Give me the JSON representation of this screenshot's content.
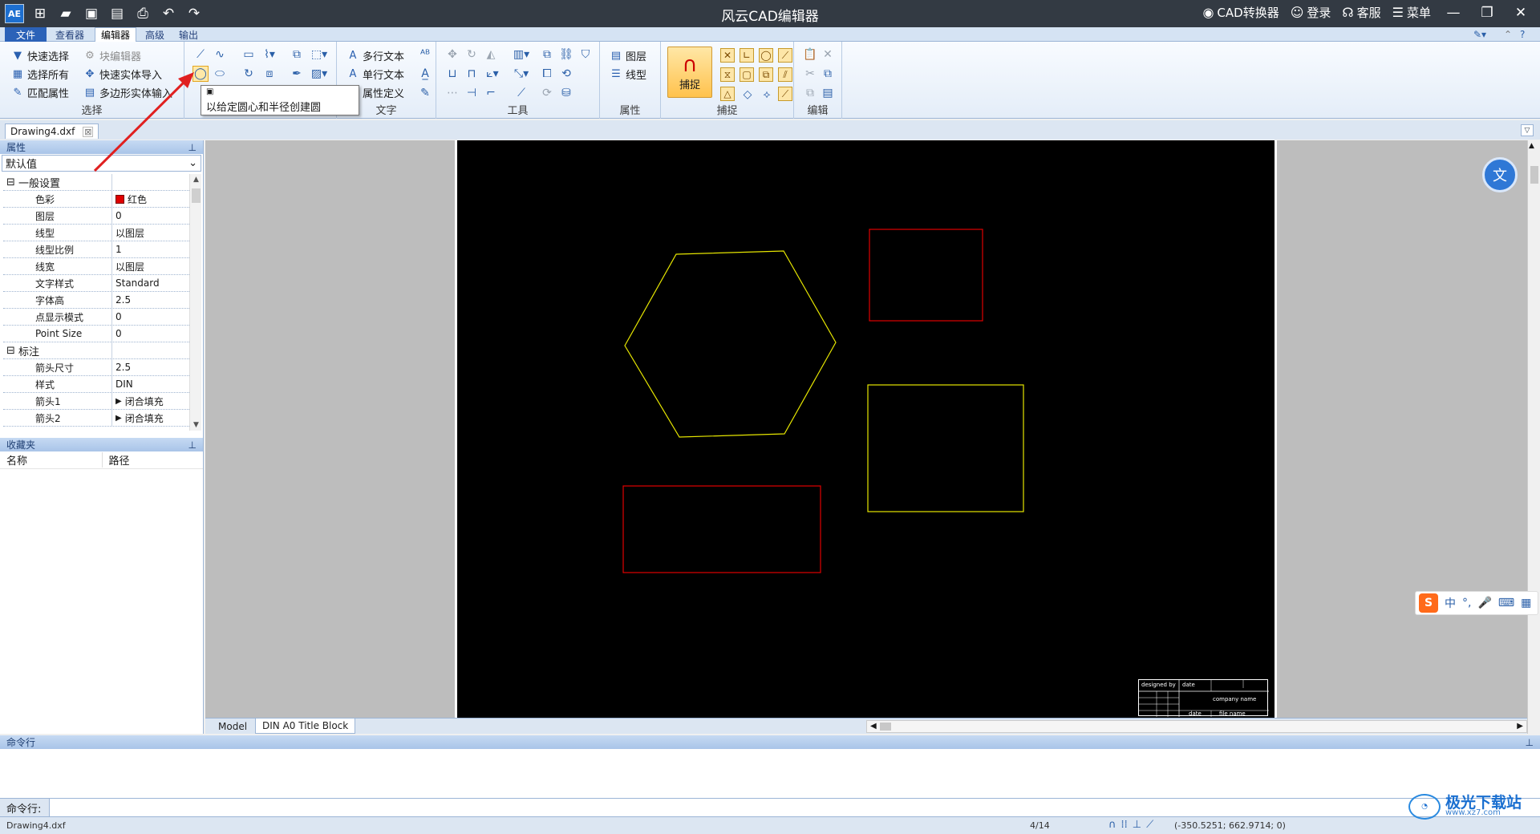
{
  "window": {
    "title": "风云CAD编辑器",
    "cad_converter": "CAD转换器",
    "login": "登录",
    "service": "客服",
    "menu": "菜单",
    "app_icon_text": "AE"
  },
  "ribbon_tabs": [
    "文件",
    "查看器",
    "编辑器",
    "高级",
    "输出"
  ],
  "ribbon": {
    "select": {
      "label": "选择",
      "quick_select": "快速选择",
      "select_all": "选择所有",
      "match_props": "匹配属性",
      "block_editor": "块编辑器",
      "quick_entity_import": "快速实体导入",
      "polygon_entity_input": "多边形实体输入"
    },
    "draw_tooltip": "以给定圆心和半径创建圆",
    "text": {
      "label": "文字",
      "mtext": "多行文本",
      "stext": "单行文本",
      "attdef": "属性定义"
    },
    "tools": {
      "label": "工具"
    },
    "props": {
      "label": "属性",
      "layer": "图层",
      "linetype": "线型"
    },
    "snap": {
      "label": "捕捉",
      "button": "捕捉"
    },
    "edit": {
      "label": "编辑"
    }
  },
  "doc_tab": "Drawing4.dxf",
  "properties": {
    "header": "属性",
    "selector": "默认值",
    "general_category": "一般设置",
    "rows": [
      {
        "name": "色彩",
        "value": "红色"
      },
      {
        "name": "图层",
        "value": "0"
      },
      {
        "name": "线型",
        "value": "以图层"
      },
      {
        "name": "线型比例",
        "value": "1"
      },
      {
        "name": "线宽",
        "value": "以图层"
      },
      {
        "name": "文字样式",
        "value": "Standard"
      },
      {
        "name": "字体高",
        "value": "2.5"
      },
      {
        "name": "点显示模式",
        "value": "0"
      },
      {
        "name": "Point Size",
        "value": "0"
      }
    ],
    "dim_category": "标注",
    "dim_rows": [
      {
        "name": "箭头尺寸",
        "value": "2.5"
      },
      {
        "name": "样式",
        "value": "DIN"
      },
      {
        "name": "箭头1",
        "value": "闭合填充"
      },
      {
        "name": "箭头2",
        "value": "闭合填充"
      }
    ]
  },
  "favorites": {
    "header": "收藏夹",
    "col_name": "名称",
    "col_path": "路径"
  },
  "layout_tabs": [
    "Model",
    "DIN A0 Title Block"
  ],
  "title_block": {
    "designed_by": "designed by",
    "date_lbl": "date",
    "company": "company name",
    "date2": "date",
    "file_name": "file name"
  },
  "command": {
    "header": "命令行",
    "prompt": "命令行:"
  },
  "status": {
    "file": "Drawing4.dxf",
    "page": "4/14",
    "coords": "(-350.5251; 662.9714; 0)"
  },
  "ime": {
    "brand": "S",
    "chinese": "中"
  },
  "watermark": {
    "title": "极光下载站",
    "site": "www.xz7.com"
  },
  "colors": {
    "accent": "#2b62b8",
    "red_entity": "#e00000",
    "yellow_entity": "#e6e600"
  }
}
